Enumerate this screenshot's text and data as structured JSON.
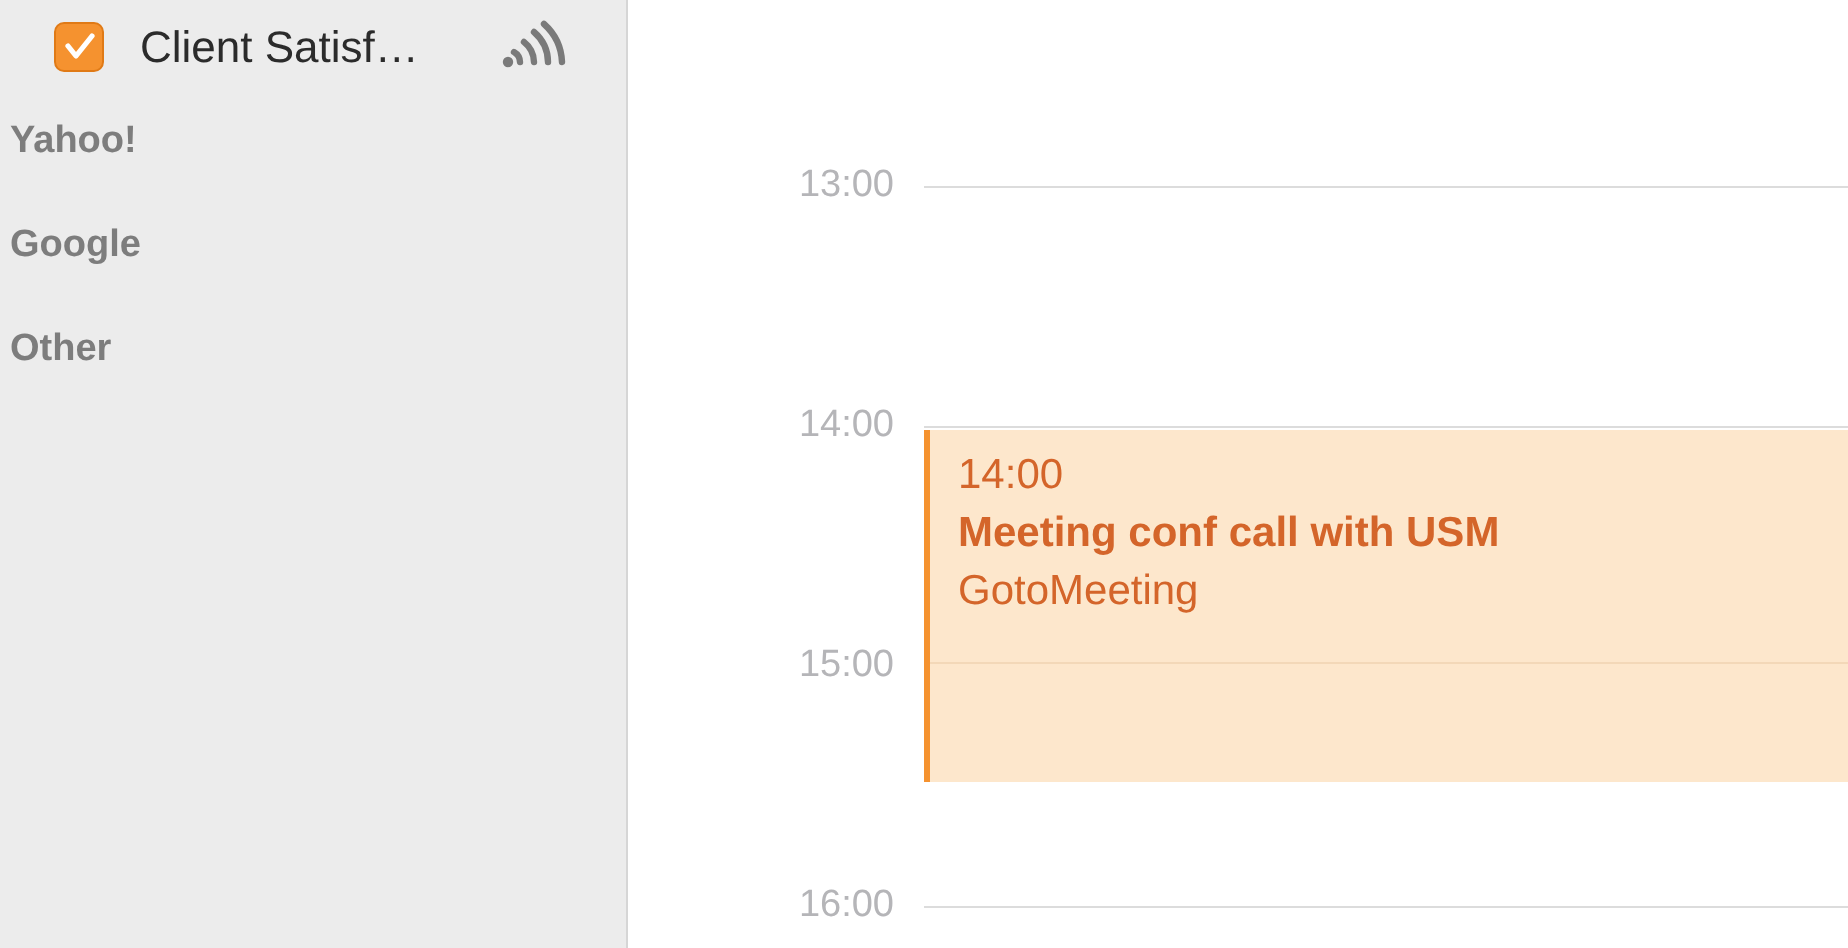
{
  "sidebar": {
    "calendars": [
      {
        "name": "Client Satisf…",
        "checked": true
      }
    ],
    "groups": [
      "Yahoo!",
      "Google",
      "Other"
    ]
  },
  "day_view": {
    "hours": [
      "13:00",
      "14:00",
      "15:00",
      "16:00"
    ],
    "event": {
      "time": "14:00",
      "title": "Meeting conf call with USM",
      "location": "GotoMeeting"
    }
  }
}
